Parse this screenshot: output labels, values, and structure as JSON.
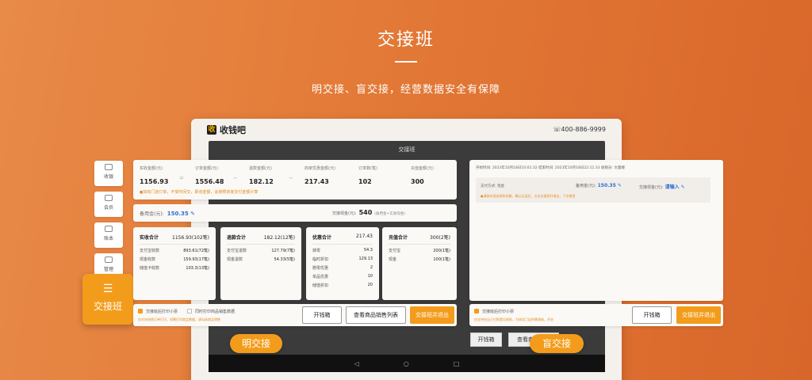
{
  "hero": {
    "title": "交接班",
    "subtitle": "明交接、盲交接，经营数据安全有保障"
  },
  "device": {
    "logo_mark": "收",
    "brand": "收钱吧",
    "phone": "☏400-886-9999",
    "screen_title": "交接班",
    "screen_btn_drawer": "开钱箱",
    "screen_btn_list": "查看商品销售",
    "nav_back": "◁",
    "nav_home": "○",
    "nav_recent": "□"
  },
  "sidebar": {
    "items": [
      {
        "label": "收银",
        "icon": "cashier-icon"
      },
      {
        "label": "会员",
        "icon": "member-icon"
      },
      {
        "label": "账本",
        "icon": "ledger-icon"
      },
      {
        "label": "管理",
        "icon": "manage-icon"
      }
    ],
    "active": {
      "label": "交接班",
      "icon": "sliders-icon",
      "glyph": "☰"
    }
  },
  "summary": {
    "cols": [
      {
        "label": "实收金额(元)",
        "value": "1156.93"
      },
      {
        "label": "订单金额(元)",
        "value": "1556.48"
      },
      {
        "label": "退款金额(元)",
        "value": "182.12"
      },
      {
        "label": "商家优惠金额(元)",
        "value": "217.43"
      },
      {
        "label": "订单数(笔)",
        "value": "102"
      },
      {
        "label": "充值金额(元)",
        "value": "300"
      }
    ],
    "ops": [
      "=",
      "−",
      "−"
    ],
    "note": "●如有门店订单，不受时间交，即该金额，会按照商家支付金额计算"
  },
  "cash": {
    "petty_label": "备用金(元):",
    "petty_value": "150.35 ✎",
    "handover_label": "交接现金(元):",
    "handover_value": "540",
    "handover_hint": "(备用金+实收现金)"
  },
  "stats": [
    {
      "title": "实收合计",
      "total": "1156.93(102笔)",
      "rows": [
        [
          "支付宝收款",
          "893.61(72笔)"
        ],
        [
          "现金收款",
          "159.93(17笔)"
        ],
        [
          "储值卡收款",
          "103.3(13笔)"
        ]
      ]
    },
    {
      "title": "退款合计",
      "total": "182.12(12笔)",
      "rows": [
        [
          "支付宝退款",
          "127.79(7笔)"
        ],
        [
          "现金退款",
          "54.33(5笔)"
        ]
      ]
    },
    {
      "title": "优惠合计",
      "total": "217.43",
      "rows": [
        [
          "抹零",
          "54.3"
        ],
        [
          "临时折扣",
          "129.13"
        ],
        [
          "赠零优惠",
          "2"
        ],
        [
          "单品优惠",
          "10"
        ],
        [
          "储值折扣",
          "20"
        ]
      ]
    },
    {
      "title": "充值合计",
      "total": "300(2笔)",
      "rows": [
        [
          "支付宝",
          "200(1笔)"
        ],
        [
          "现金",
          "100(1笔)"
        ]
      ]
    }
  ],
  "actions_left": {
    "print_label": "交接班后打印小票",
    "print_goods_label": "同时打印商品销售数据",
    "note": "仅对未核销订单打印，如需打印商品数据，请勾选商品销售",
    "drawer_btn": "开钱箱",
    "list_btn": "查看商品销售列表",
    "exit_btn": "交接班并退出"
  },
  "right_panel": {
    "top": "开始时间: 2023年10月18日10:01:32      结束时间: 2023年10月18日22:11:33      收银员: 文曼娜",
    "pay_label": "支付方式: 现金",
    "petty_label": "备用金(元):",
    "petty_value": "150.35 ✎",
    "handover_label": "交接现金(元):",
    "handover_value": "请输入 ✎",
    "note": "●请核对现金收款金额，确认无误后，点击交接班并退出，下次使用",
    "print_label": "交接班后打印小票",
    "note2": "仅支持在自己付款登记收款，为核实门店所需请核，开启",
    "drawer_btn": "开钱箱",
    "exit_btn": "交接班并退出"
  },
  "pills": {
    "open": "明交接",
    "blind": "盲交接"
  },
  "colors": {
    "accent": "#f39c1b",
    "link": "#2a6fd6",
    "background": "#e37936"
  }
}
